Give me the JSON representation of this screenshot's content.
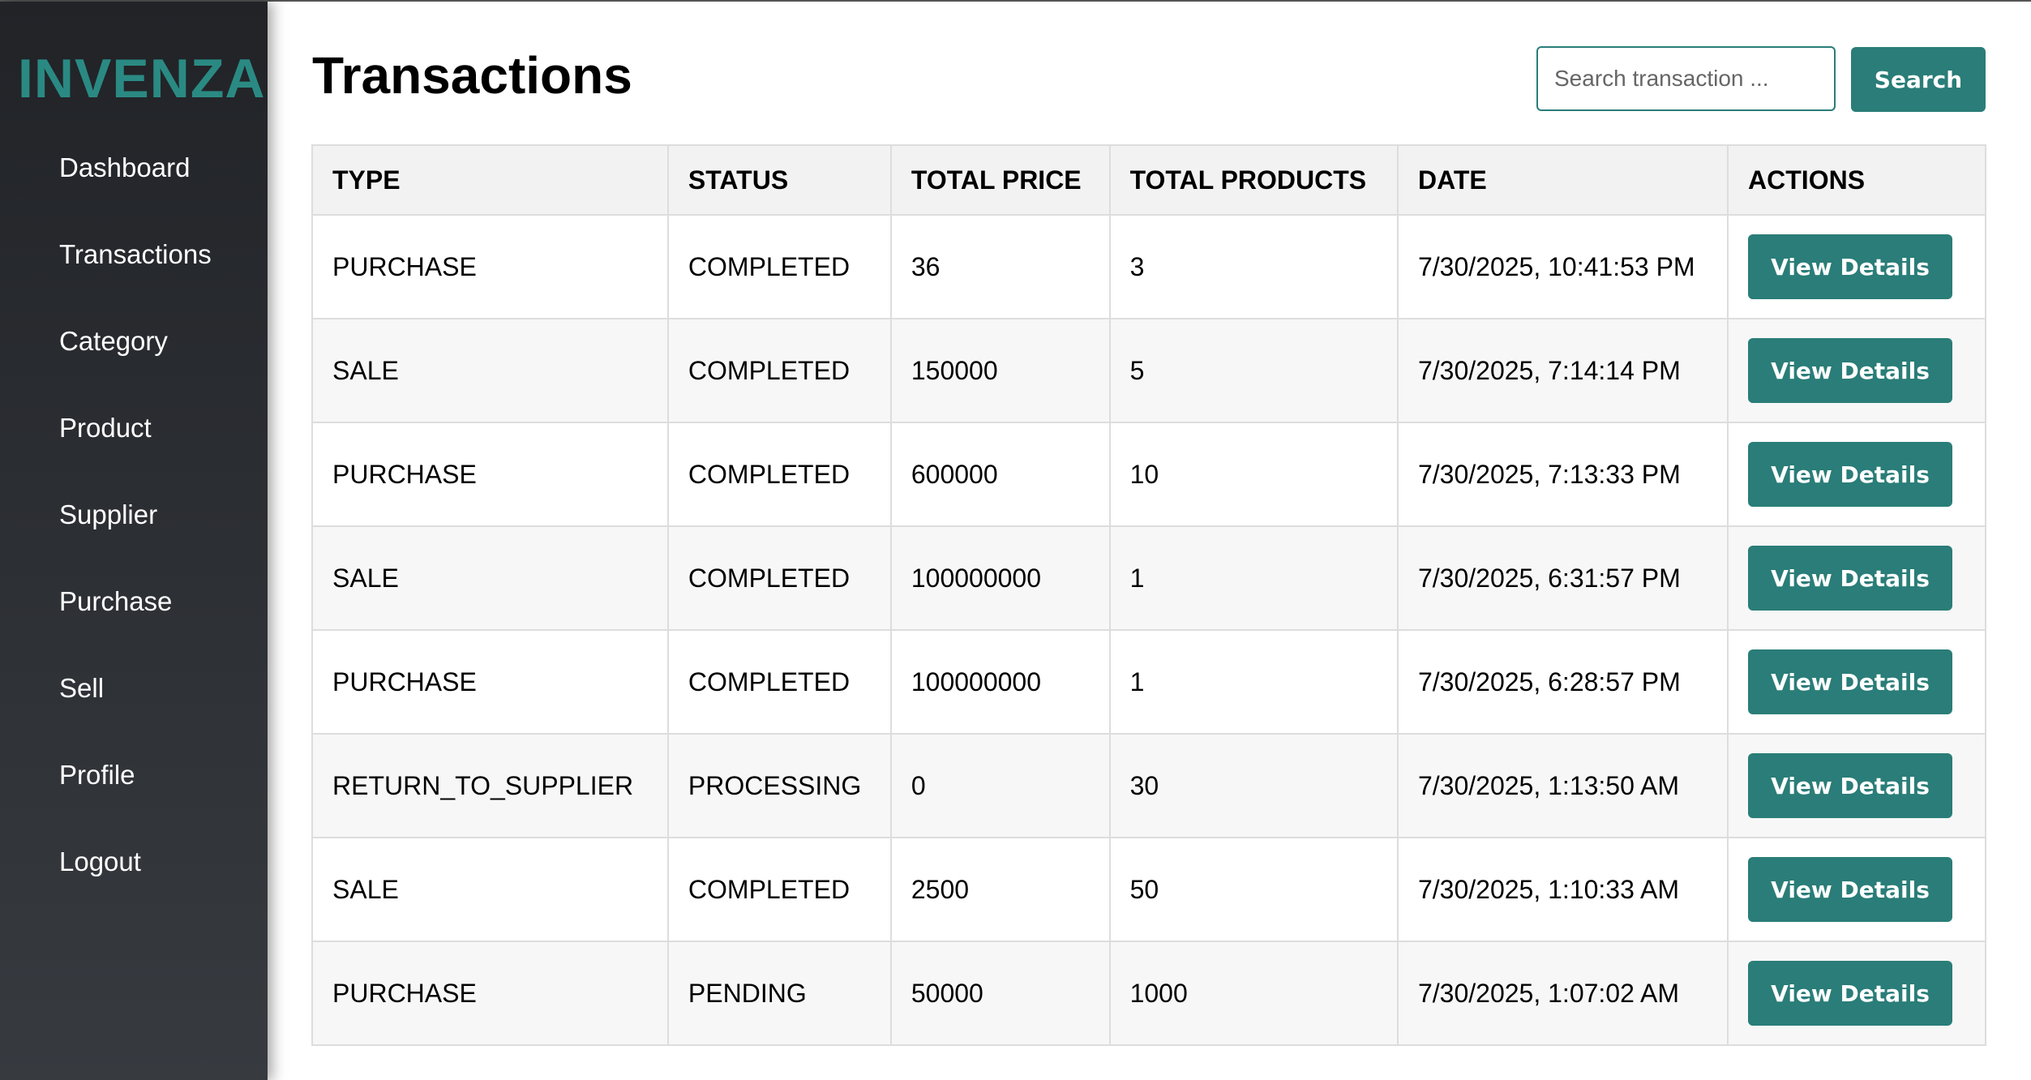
{
  "sidebar": {
    "logo": "INVENZA",
    "items": [
      {
        "label": "Dashboard"
      },
      {
        "label": "Transactions"
      },
      {
        "label": "Category"
      },
      {
        "label": "Product"
      },
      {
        "label": "Supplier"
      },
      {
        "label": "Purchase"
      },
      {
        "label": "Sell"
      },
      {
        "label": "Profile"
      },
      {
        "label": "Logout"
      }
    ]
  },
  "main": {
    "title": "Transactions",
    "search": {
      "placeholder": "Search transaction ...",
      "value": "",
      "button_label": "Search"
    },
    "table": {
      "headers": [
        "TYPE",
        "STATUS",
        "TOTAL PRICE",
        "TOTAL PRODUCTS",
        "DATE",
        "ACTIONS"
      ],
      "action_label": "View Details",
      "rows": [
        {
          "type": "PURCHASE",
          "status": "COMPLETED",
          "total_price": "36",
          "total_products": "3",
          "date": "7/30/2025, 10:41:53 PM"
        },
        {
          "type": "SALE",
          "status": "COMPLETED",
          "total_price": "150000",
          "total_products": "5",
          "date": "7/30/2025, 7:14:14 PM"
        },
        {
          "type": "PURCHASE",
          "status": "COMPLETED",
          "total_price": "600000",
          "total_products": "10",
          "date": "7/30/2025, 7:13:33 PM"
        },
        {
          "type": "SALE",
          "status": "COMPLETED",
          "total_price": "100000000",
          "total_products": "1",
          "date": "7/30/2025, 6:31:57 PM"
        },
        {
          "type": "PURCHASE",
          "status": "COMPLETED",
          "total_price": "100000000",
          "total_products": "1",
          "date": "7/30/2025, 6:28:57 PM"
        },
        {
          "type": "RETURN_TO_SUPPLIER",
          "status": "PROCESSING",
          "total_price": "0",
          "total_products": "30",
          "date": "7/30/2025, 1:13:50 AM"
        },
        {
          "type": "SALE",
          "status": "COMPLETED",
          "total_price": "2500",
          "total_products": "50",
          "date": "7/30/2025, 1:10:33 AM"
        },
        {
          "type": "PURCHASE",
          "status": "PENDING",
          "total_price": "50000",
          "total_products": "1000",
          "date": "7/30/2025, 1:07:02 AM"
        }
      ]
    }
  },
  "colors": {
    "accent": "#2a7d78",
    "logo": "#2a8a83",
    "sidebar_top": "#212327",
    "sidebar_bottom": "#373b40"
  }
}
